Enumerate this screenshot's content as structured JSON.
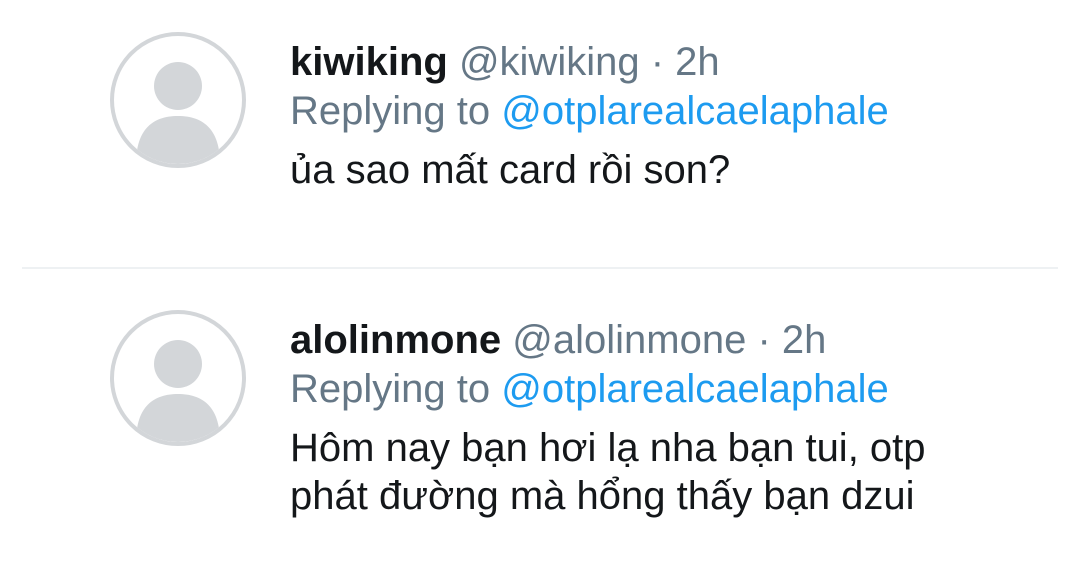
{
  "tweets": [
    {
      "display_name": "kiwiking",
      "handle": "@kiwiking",
      "separator": " · ",
      "time": "2h",
      "replying_prefix": "Replying to ",
      "replying_to": "@otplarealcaelaphale",
      "text": "ủa sao mất card rồi son?",
      "avatar_icon": "default-profile-icon"
    },
    {
      "display_name": "alolinmone",
      "handle": "@alolinmone",
      "separator": " · ",
      "time": "2h",
      "replying_prefix": "Replying to ",
      "replying_to": "@otplarealcaelaphale",
      "text": "Hôm nay bạn hơi lạ nha bạn tui, otp\nphát đường mà hổng thấy bạn dzui",
      "avatar_icon": "default-profile-icon"
    }
  ],
  "colors": {
    "text": "#14171a",
    "muted": "#657786",
    "link": "#1d9bf0",
    "avatar_ring": "#d3d6d9",
    "avatar_silhouette": "#d3d6d9",
    "divider": "#eef1f3"
  }
}
